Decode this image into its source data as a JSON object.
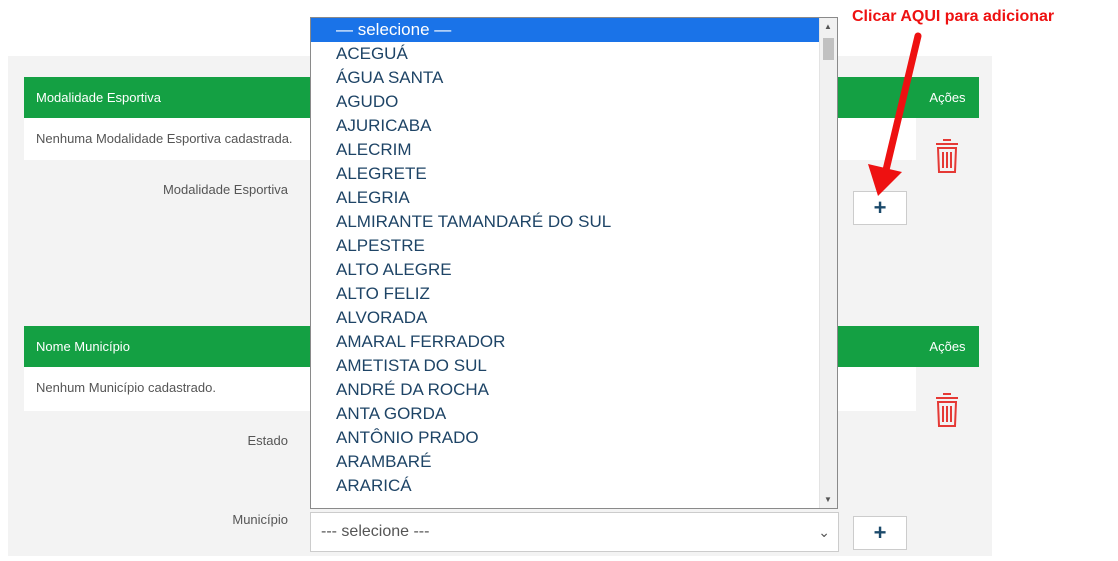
{
  "annotation": {
    "text": "Clicar AQUI para adicionar",
    "color": "#ee1111"
  },
  "section1": {
    "header": "Modalidade Esportiva",
    "actions_header": "Ações",
    "empty_message": "Nenhuma Modalidade Esportiva cadastrada.",
    "field_label": "Modalidade Esportiva",
    "add_button": "+"
  },
  "section2": {
    "header": "Nome Município",
    "actions_header": "Ações",
    "empty_message": "Nenhum Município cadastrado.",
    "estado_label": "Estado",
    "municipio_label": "Município",
    "select_value": "--- selecione ---",
    "add_button": "+"
  },
  "dropdown": {
    "options": [
      "— selecione —",
      "ACEGUÁ",
      "ÁGUA SANTA",
      "AGUDO",
      "AJURICABA",
      "ALECRIM",
      "ALEGRETE",
      "ALEGRIA",
      "ALMIRANTE TAMANDARÉ DO SUL",
      "ALPESTRE",
      "ALTO ALEGRE",
      "ALTO FELIZ",
      "ALVORADA",
      "AMARAL FERRADOR",
      "AMETISTA DO SUL",
      "ANDRÉ DA ROCHA",
      "ANTA GORDA",
      "ANTÔNIO PRADO",
      "ARAMBARÉ",
      "ARARICÁ"
    ],
    "selected_index": 0
  },
  "colors": {
    "header_green": "#14a043",
    "highlight": "#1a73e8",
    "trash_red": "#e53935",
    "option_text": "#1e4466"
  }
}
